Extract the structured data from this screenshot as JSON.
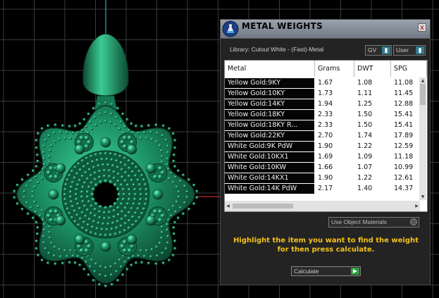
{
  "panel": {
    "title": "METAL WEIGHTS",
    "close_label": "x",
    "library_label": "Library: Cutout White - (Fast)-Metal",
    "toggle_gv": "GV",
    "toggle_user": "User",
    "table": {
      "columns": [
        "Metal",
        "Grams",
        "DWT",
        "SPG"
      ],
      "rows": [
        [
          "Yellow Gold:9KY",
          "1.67",
          "1.08",
          "11.08"
        ],
        [
          "Yellow Gold:10KY",
          "1.73",
          "1.11",
          "11.45"
        ],
        [
          "Yellow Gold:14KY",
          "1.94",
          "1.25",
          "12.88"
        ],
        [
          "Yellow Gold:18KY",
          "2.33",
          "1.50",
          "15.41"
        ],
        [
          "Yellow Gold:18KY R...",
          "2.33",
          "1.50",
          "15.41"
        ],
        [
          "Yellow Gold:22KY",
          "2.70",
          "1.74",
          "17.89"
        ],
        [
          "White Gold:9K PdW",
          "1.90",
          "1.22",
          "12.59"
        ],
        [
          "White Gold:10KX1",
          "1.69",
          "1.09",
          "11.18"
        ],
        [
          "White Gold:10KW",
          "1.66",
          "1.07",
          "10.99"
        ],
        [
          "White Gold:14KX1",
          "1.90",
          "1.22",
          "12.61"
        ],
        [
          "White Gold:14K PdW",
          "2.17",
          "1.40",
          "14.37"
        ]
      ]
    },
    "use_object_materials": "Use Object Materials",
    "instructions": "Highlight the item you want to find the weight for then press calculate.",
    "calculate_label": "Calculate",
    "icons": {
      "app_logo": "flask-icon",
      "close": "close-icon",
      "calculate": "play-arrow-icon"
    },
    "colors": {
      "accent_text": "#f2c21a",
      "toggle_blue": "#2f7a91",
      "go_green": "#2f9c3f",
      "model_green": "#1f8f66"
    }
  }
}
